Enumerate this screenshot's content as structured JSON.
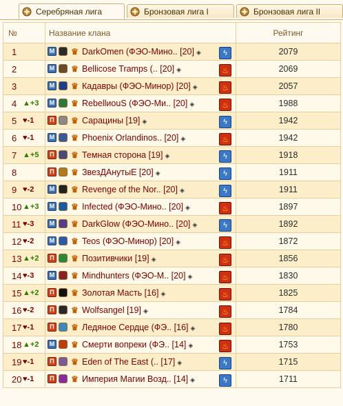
{
  "tabs": [
    {
      "label": "Серебряная лига",
      "active": true
    },
    {
      "label": "Бронзовая лига I",
      "active": false
    },
    {
      "label": "Бронзовая лига II",
      "active": false
    }
  ],
  "headers": {
    "num": "№",
    "name": "Название клана",
    "rating": "Рейтинг"
  },
  "rows": [
    {
      "num": "1",
      "delta": "",
      "dir": "",
      "type": "M",
      "emblem": "#2a2a2a",
      "name": "DarkOmen (ФЭО-Мино.. [20]",
      "element": "bolt",
      "rating": "2079"
    },
    {
      "num": "2",
      "delta": "",
      "dir": "",
      "type": "M",
      "emblem": "#6b4a2a",
      "name": "Bellicose Tramps (.. [20]",
      "element": "flame",
      "rating": "2069"
    },
    {
      "num": "3",
      "delta": "",
      "dir": "",
      "type": "M",
      "emblem": "#1d3f8a",
      "name": "Кадавры (ФЭО-Минор) [20]",
      "element": "flame",
      "rating": "2057"
    },
    {
      "num": "4",
      "delta": "+3",
      "dir": "up",
      "type": "M",
      "emblem": "#2b7a3a",
      "name": "RebellиouS (ФЭО-Ми.. [20]",
      "element": "flame",
      "rating": "1988"
    },
    {
      "num": "5",
      "delta": "-1",
      "dir": "down",
      "type": "П",
      "emblem": "#8a8a8a",
      "name": "Сарацины [19]",
      "element": "bolt",
      "rating": "1942"
    },
    {
      "num": "6",
      "delta": "-1",
      "dir": "down",
      "type": "M",
      "emblem": "#3a5a9a",
      "name": "Phoenix Orlandinos.. [20]",
      "element": "flame",
      "rating": "1942"
    },
    {
      "num": "7",
      "delta": "+5",
      "dir": "up",
      "type": "П",
      "emblem": "#4a4a7a",
      "name": "Темная сторона [19]",
      "element": "bolt",
      "rating": "1918"
    },
    {
      "num": "8",
      "delta": "",
      "dir": "",
      "type": "П",
      "emblem": "#b07a20",
      "name": "ЗвезДАнутыЕ [20]",
      "element": "bolt",
      "rating": "1911"
    },
    {
      "num": "9",
      "delta": "-2",
      "dir": "down",
      "type": "M",
      "emblem": "#222222",
      "name": "Revenge of the Nor.. [20]",
      "element": "bolt",
      "rating": "1911"
    },
    {
      "num": "10",
      "delta": "+3",
      "dir": "up",
      "type": "M",
      "emblem": "#1a5aa0",
      "name": "Infected (ФЭО-Мино.. [20]",
      "element": "flame",
      "rating": "1897"
    },
    {
      "num": "11",
      "delta": "-3",
      "dir": "down",
      "type": "M",
      "emblem": "#5a3a8a",
      "name": "DarkGlow (ФЭО-Мино.. [20]",
      "element": "bolt",
      "rating": "1892"
    },
    {
      "num": "12",
      "delta": "-2",
      "dir": "down",
      "type": "M",
      "emblem": "#2a5aaa",
      "name": "Teos (ФЭО-Минор) [20]",
      "element": "flame",
      "rating": "1872"
    },
    {
      "num": "13",
      "delta": "+2",
      "dir": "up",
      "type": "П",
      "emblem": "#2a8a3a",
      "name": "Позитивчики [19]",
      "element": "flame",
      "rating": "1856"
    },
    {
      "num": "14",
      "delta": "-3",
      "dir": "down",
      "type": "M",
      "emblem": "#8a2020",
      "name": "Mindhunters (ФЭО-М.. [20]",
      "element": "flame",
      "rating": "1830"
    },
    {
      "num": "15",
      "delta": "+2",
      "dir": "up",
      "type": "П",
      "emblem": "#111111",
      "name": "Золотая Масть [16]",
      "element": "flame",
      "rating": "1825"
    },
    {
      "num": "16",
      "delta": "-2",
      "dir": "down",
      "type": "П",
      "emblem": "#2a2a2a",
      "name": "Wolfsangel [19]",
      "element": "flame",
      "rating": "1784"
    },
    {
      "num": "17",
      "delta": "-1",
      "dir": "down",
      "type": "П",
      "emblem": "#3a8ac0",
      "name": "Ледяное Сердце (ФЭ.. [16]",
      "element": "flame",
      "rating": "1780"
    },
    {
      "num": "18",
      "delta": "+2",
      "dir": "up",
      "type": "M",
      "emblem": "#c03a10",
      "name": "Смерти вопреки (ФЭ.. [14]",
      "element": "flame",
      "rating": "1753"
    },
    {
      "num": "19",
      "delta": "-1",
      "dir": "down",
      "type": "П",
      "emblem": "#7a5a9a",
      "name": "Eden of The East (.. [17]",
      "element": "bolt",
      "rating": "1715"
    },
    {
      "num": "20",
      "delta": "-1",
      "dir": "down",
      "type": "П",
      "emblem": "#8a2aa0",
      "name": "Империя Магии Возд.. [14]",
      "element": "bolt",
      "rating": "1711"
    }
  ]
}
